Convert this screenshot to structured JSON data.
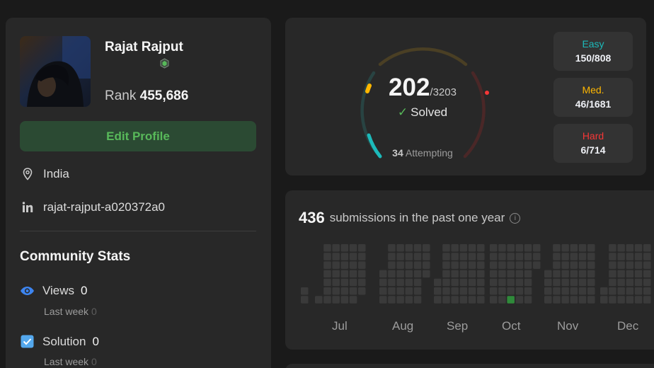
{
  "profile": {
    "username": "Rajat Rajput",
    "rank_label": "Rank",
    "rank_value": "455,686",
    "edit_profile_label": "Edit Profile",
    "location": "India",
    "linkedin": "rajat-rajput-a020372a0"
  },
  "community": {
    "title": "Community Stats",
    "views_label": "Views",
    "views_value": "0",
    "views_last_week_label": "Last week",
    "views_last_week_value": "0",
    "solution_label": "Solution",
    "solution_value": "0",
    "solution_last_week_label": "Last week",
    "solution_last_week_value": "0"
  },
  "solved": {
    "count": "202",
    "total": "/3203",
    "label": "Solved",
    "attempting_count": "34",
    "attempting_label": "Attempting",
    "difficulties": [
      {
        "label": "Easy",
        "value": "150/808",
        "color": "#1cbaba"
      },
      {
        "label": "Med.",
        "value": "46/1681",
        "color": "#ffb700"
      },
      {
        "label": "Hard",
        "value": "6/714",
        "color": "#f63737"
      }
    ]
  },
  "calendar": {
    "count": "436",
    "label": "submissions in the past one year",
    "info_icon": "info-icon",
    "months": [
      "Jul",
      "Aug",
      "Sep",
      "Oct",
      "Nov",
      "Dec"
    ]
  },
  "colors": {
    "easy": "#1cbaba",
    "medium": "#ffb700",
    "hard": "#f63737",
    "accent_green": "#58b95a",
    "cell_empty": "#3a3a3a",
    "cell_active": "#2f8a3a"
  }
}
